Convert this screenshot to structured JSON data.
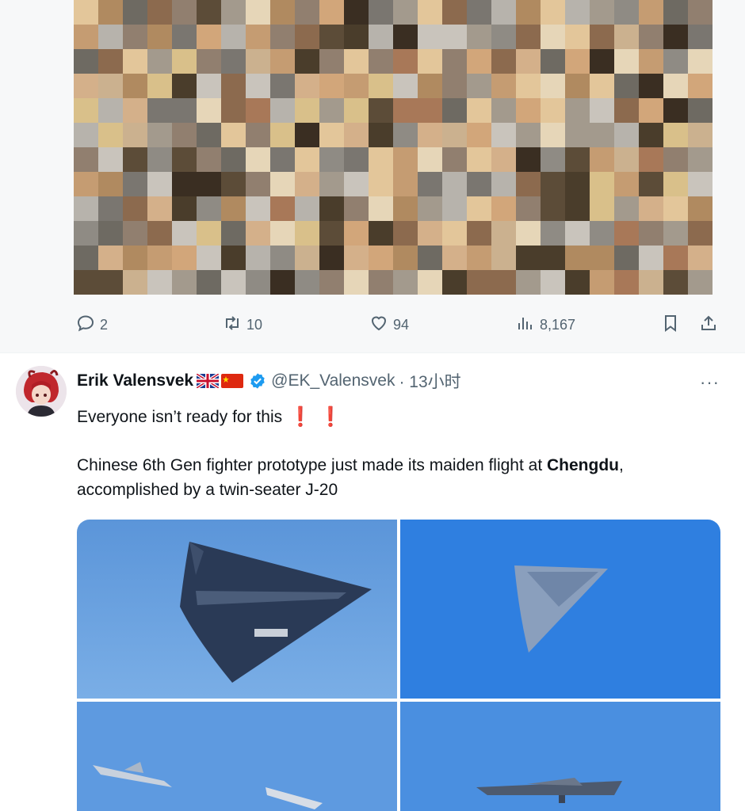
{
  "previous_tweet": {
    "actions": {
      "reply_count": "2",
      "retweet_count": "10",
      "like_count": "94",
      "view_count": "8,167"
    }
  },
  "tweet": {
    "author": {
      "name": "Erik Valensvek",
      "handle": "@EK_Valensvek",
      "time": "· 13小时"
    },
    "line1": "Everyone isn’t ready for this",
    "exclamations": [
      "❗",
      "❗"
    ],
    "body_before": "Chinese 6th Gen fighter prototype just made its maiden flight at ",
    "body_bold": "Chengdu",
    "body_after": ", accomplished by a twin-seater J-20",
    "more_label": "···"
  },
  "colors": {
    "secondary_text": "#536471",
    "verified_blue": "#1d9bf0",
    "sky_blue": "#4a8fe0",
    "divider": "#eff3f4"
  },
  "icons": [
    "reply-icon",
    "retweet-icon",
    "like-icon",
    "views-icon",
    "bookmark-icon",
    "share-icon",
    "verified-badge-icon",
    "more-icon"
  ]
}
